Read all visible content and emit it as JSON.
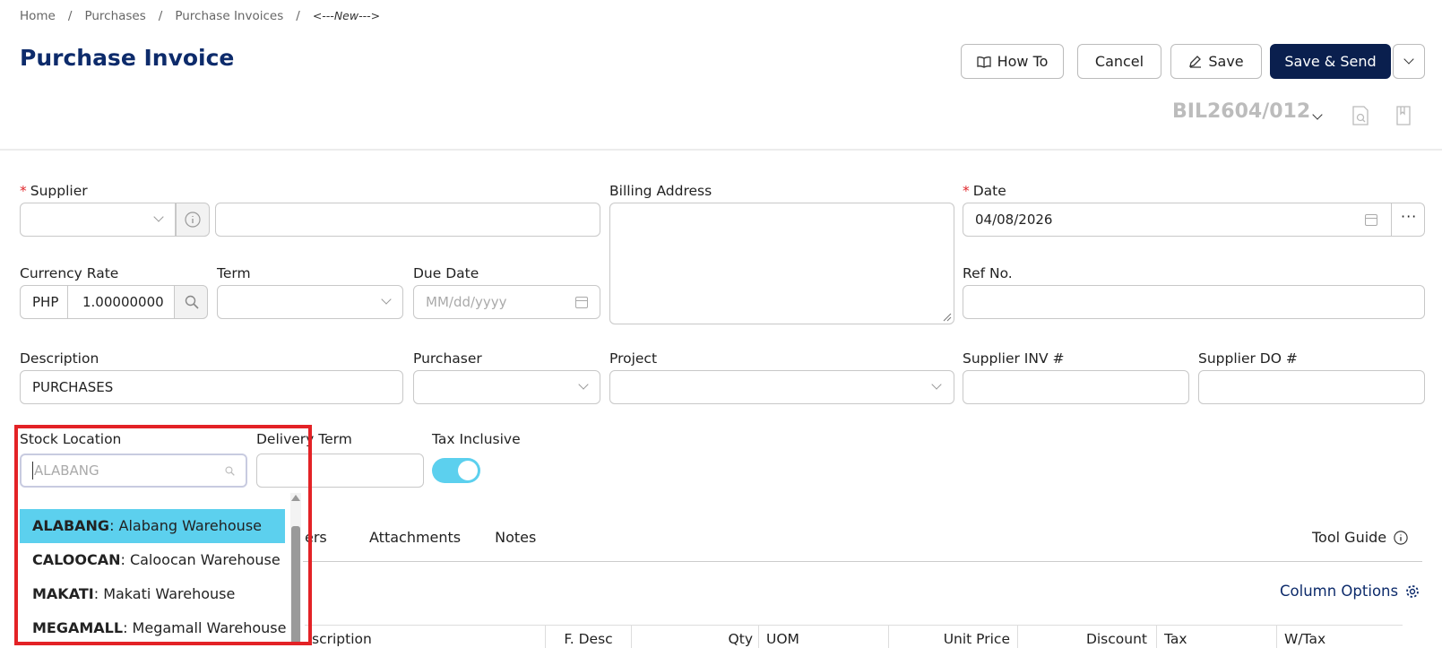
{
  "breadcrumb": [
    "Home",
    "Purchases",
    "Purchase Invoices",
    "<---New--->"
  ],
  "page_title": "Purchase Invoice",
  "toolbar": {
    "howto": "How To",
    "cancel": "Cancel",
    "save": "Save",
    "save_send": "Save & Send"
  },
  "doc_number": "BIL2604/012",
  "form": {
    "supplier_label": "Supplier",
    "billing_address_label": "Billing Address",
    "date_label": "Date",
    "date_value": "04/08/2026",
    "currency_rate_label": "Currency Rate",
    "currency_code": "PHP",
    "currency_rate": "1.00000000",
    "term_label": "Term",
    "due_date_label": "Due Date",
    "due_date_placeholder": "MM/dd/yyyy",
    "ref_no_label": "Ref No.",
    "description_label": "Description",
    "description_value": "PURCHASES",
    "purchaser_label": "Purchaser",
    "project_label": "Project",
    "supplier_inv_label": "Supplier INV #",
    "supplier_do_label": "Supplier DO #",
    "stock_location_label": "Stock Location",
    "stock_location_search": "ALABANG",
    "delivery_term_label": "Delivery Term",
    "tax_inclusive_label": "Tax Inclusive",
    "tax_inclusive_on": true
  },
  "stock_location_options": [
    {
      "code": "ALABANG",
      "name": ": Alabang Warehouse",
      "selected": true
    },
    {
      "code": "CALOOCAN",
      "name": ": Caloocan Warehouse",
      "selected": false
    },
    {
      "code": "MAKATI",
      "name": ": Makati Warehouse",
      "selected": false
    },
    {
      "code": "MEGAMALL",
      "name": ": Megamall Warehouse",
      "selected": false
    }
  ],
  "tabs": {
    "partial": "ers",
    "attachments": "Attachments",
    "notes": "Notes",
    "tool_guide": "Tool Guide"
  },
  "column_options": "Column Options",
  "table_headers": {
    "description_partial": "scription",
    "fdesc": "F. Desc",
    "qty": "Qty",
    "uom": "UOM",
    "unit_price": "Unit Price",
    "discount": "Discount",
    "tax": "Tax",
    "wtax": "W/Tax"
  },
  "colors": {
    "brand": "#0d2b6b",
    "primary_button": "#0a1f4e",
    "highlight": "#5cd0ee",
    "required": "#e0262b",
    "annotation": "#e32226"
  }
}
